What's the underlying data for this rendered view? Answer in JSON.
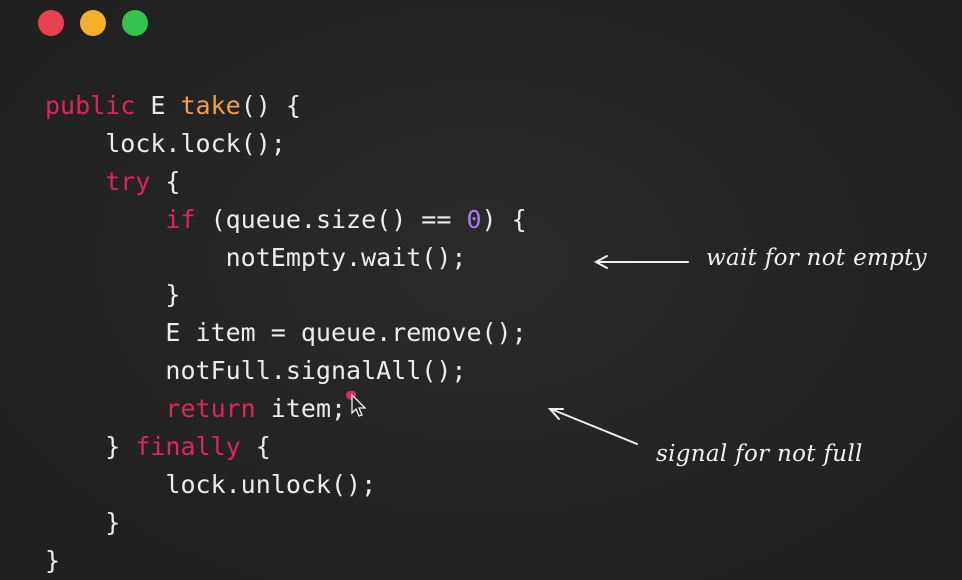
{
  "window": {
    "buttons": [
      {
        "name": "close",
        "color": "#e9414f"
      },
      {
        "name": "minimize",
        "color": "#f5b02b"
      },
      {
        "name": "maximize",
        "color": "#35c350"
      }
    ]
  },
  "colors": {
    "background": "#232323",
    "keyword": "#e0245e",
    "function": "#f29d49",
    "number": "#a77cf2",
    "text": "#ececec"
  },
  "code": {
    "lines": [
      {
        "indent": "",
        "tokens": [
          {
            "t": "public",
            "c": "kw"
          },
          {
            "t": " E ",
            "c": "plain"
          },
          {
            "t": "take",
            "c": "fn"
          },
          {
            "t": "() {",
            "c": "plain"
          }
        ]
      },
      {
        "indent": "    ",
        "tokens": [
          {
            "t": "lock.lock();",
            "c": "plain"
          }
        ]
      },
      {
        "indent": "    ",
        "tokens": [
          {
            "t": "try",
            "c": "kw"
          },
          {
            "t": " {",
            "c": "plain"
          }
        ]
      },
      {
        "indent": "        ",
        "tokens": [
          {
            "t": "if",
            "c": "kw"
          },
          {
            "t": " (queue.size() == ",
            "c": "plain"
          },
          {
            "t": "0",
            "c": "num"
          },
          {
            "t": ") {",
            "c": "plain"
          }
        ]
      },
      {
        "indent": "            ",
        "tokens": [
          {
            "t": "notEmpty.wait();",
            "c": "plain"
          }
        ]
      },
      {
        "indent": "        ",
        "tokens": [
          {
            "t": "}",
            "c": "plain"
          }
        ]
      },
      {
        "indent": "        ",
        "tokens": [
          {
            "t": "E item = queue.remove();",
            "c": "plain"
          }
        ]
      },
      {
        "indent": "        ",
        "tokens": [
          {
            "t": "notFull.signalAll();",
            "c": "plain"
          }
        ]
      },
      {
        "indent": "        ",
        "tokens": [
          {
            "t": "return",
            "c": "kw"
          },
          {
            "t": " item;",
            "c": "plain"
          }
        ]
      },
      {
        "indent": "    ",
        "tokens": [
          {
            "t": "} ",
            "c": "plain"
          },
          {
            "t": "finally",
            "c": "kw"
          },
          {
            "t": " {",
            "c": "plain"
          }
        ]
      },
      {
        "indent": "        ",
        "tokens": [
          {
            "t": "lock.unlock();",
            "c": "plain"
          }
        ]
      },
      {
        "indent": "    ",
        "tokens": [
          {
            "t": "}",
            "c": "plain"
          }
        ]
      },
      {
        "indent": "",
        "tokens": [
          {
            "t": "}",
            "c": "plain"
          }
        ]
      }
    ]
  },
  "annotations": {
    "wait_note": "wait for not empty",
    "signal_note": "signal for not full"
  }
}
